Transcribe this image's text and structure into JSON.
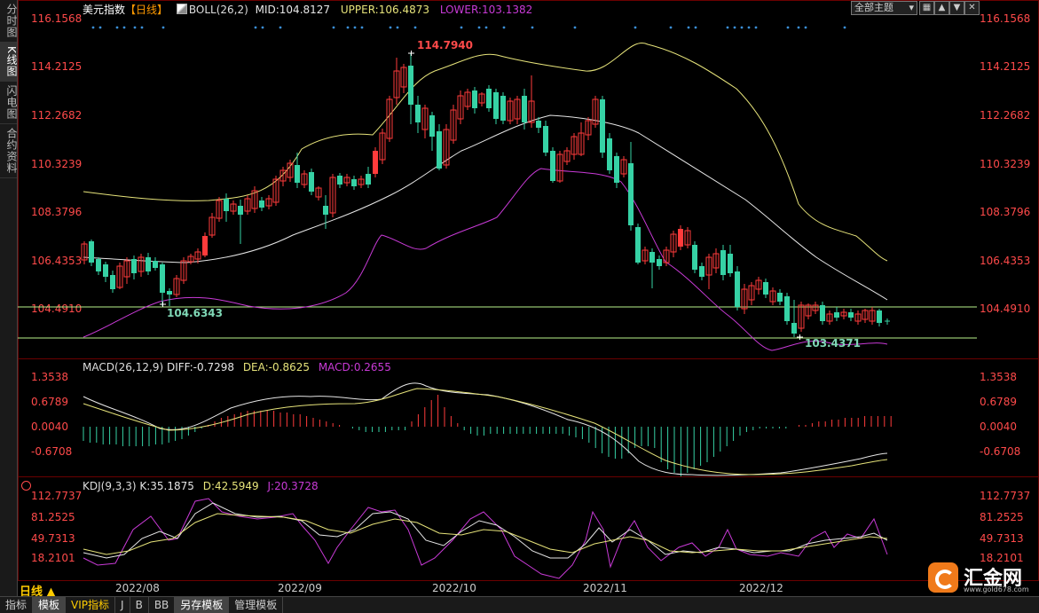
{
  "sidebar": {
    "tabs": [
      "分时图",
      "K线图",
      "闪电图",
      "合约资料"
    ]
  },
  "main": {
    "symbol": "美元指数",
    "period": "【日线】",
    "indicator_name": "BOLL(26,2)",
    "mid": "MID:104.8127",
    "upper": "UPPER:106.4873",
    "lower": "LOWER:103.1382",
    "theme_select": "全部主题",
    "y_labels": [
      "116.1568",
      "114.2125",
      "112.2682",
      "110.3239",
      "108.3796",
      "106.4353",
      "104.4910"
    ],
    "high_label": "114.7940",
    "low_label": "104.6343",
    "low_label2": "103.4371"
  },
  "macd": {
    "name": "MACD(26,12,9)",
    "diff": "DIFF:-0.7298",
    "dea": "DEA:-0.8625",
    "macd": "MACD:0.2655",
    "y_labels": [
      "1.3538",
      "0.6789",
      "0.0040",
      "-0.6708"
    ]
  },
  "kdj": {
    "name": "KDJ(9,3,3)",
    "k": "K:35.1875",
    "d": "D:42.5949",
    "j": "J:20.3728",
    "y_labels": [
      "112.7737",
      "81.2525",
      "49.7313",
      "18.2101"
    ]
  },
  "xaxis": {
    "period": "日线 ▲",
    "labels": [
      "2022/08",
      "2022/09",
      "2022/10",
      "2022/11",
      "2022/12"
    ]
  },
  "bottom": {
    "tabs": [
      "指标",
      "模板",
      "VIP指标",
      "J",
      "B",
      "BB",
      "另存模板",
      "管理模板"
    ]
  },
  "logo": {
    "text": "汇金网",
    "url": "www.gold678.com"
  },
  "colors": {
    "up": "#ff3b3b",
    "down": "#36d2a5",
    "mid": "#e6e6e6",
    "upper": "#e6e37a",
    "lower": "#c83ad6",
    "hline": "#b8f28a"
  }
}
